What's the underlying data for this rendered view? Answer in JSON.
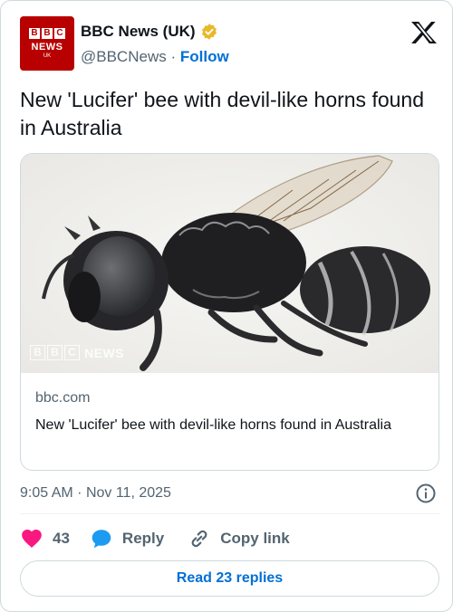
{
  "account": {
    "name": "BBC News (UK)",
    "handle": "@BBCNews",
    "separator": "·",
    "follow_label": "Follow",
    "avatar_letters": [
      "B",
      "B",
      "C"
    ],
    "avatar_word": "NEWS",
    "avatar_sub": "UK",
    "avatar_color": "#b80000",
    "verified_icon": "gold-verified-badge"
  },
  "tweet": {
    "text": "New 'Lucifer' bee with devil-like horns found in Australia"
  },
  "link_card": {
    "image_subject": "bee",
    "watermark_letters": [
      "B",
      "B",
      "C"
    ],
    "watermark_word": "NEWS",
    "domain": "bbc.com",
    "title": "New 'Lucifer' bee with devil-like horns found in Australia"
  },
  "meta": {
    "time": "9:05 AM",
    "separator": "·",
    "date": "Nov 11, 2025",
    "info_icon": "info-icon"
  },
  "actions": {
    "like_count": "43",
    "reply_label": "Reply",
    "copy_label": "Copy link",
    "like_color": "#f91880",
    "reply_color": "#1d9bf0"
  },
  "read_replies": {
    "label": "Read 23 replies"
  },
  "brand": {
    "platform_icon": "x-logo",
    "link_color": "#006fd6"
  }
}
